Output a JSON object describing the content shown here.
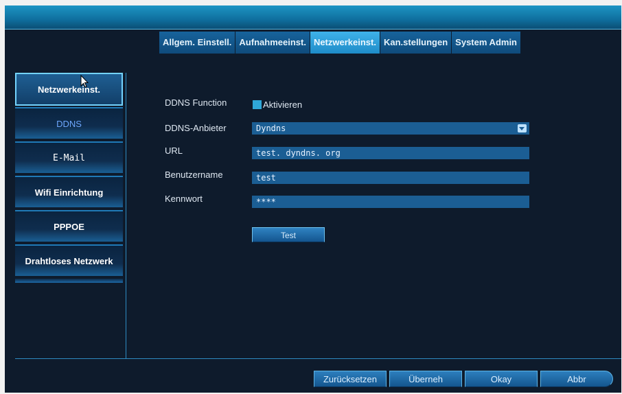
{
  "tabs": [
    {
      "label": "Allgem. Einstell."
    },
    {
      "label": "Aufnahmeeinst."
    },
    {
      "label": "Netzwerkeinst."
    },
    {
      "label": "Kan.stellungen"
    },
    {
      "label": "System Admin"
    }
  ],
  "active_tab": "Netzwerkeinst.",
  "sidebar": {
    "items": [
      {
        "label": "Netzwerkeinst."
      },
      {
        "label": "DDNS"
      },
      {
        "label": "E-Mail"
      },
      {
        "label": "Wifi Einrichtung"
      },
      {
        "label": "PPPOE"
      },
      {
        "label": "Drahtloses Netzwerk"
      }
    ],
    "selected": "Netzwerkeinst."
  },
  "form": {
    "ddns_function_label": "DDNS Function",
    "aktivieren_label": "Aktivieren",
    "aktivieren_checked": true,
    "provider_label": "DDNS-Anbieter",
    "provider_value": "Dyndns",
    "url_label": "URL",
    "url_value": "test. dyndns. org",
    "user_label": "Benutzername",
    "user_value": "test",
    "password_label": "Kennwort",
    "password_value": "****",
    "test_button": "Test"
  },
  "footer": {
    "reset": "Zurücksetzen",
    "apply": "Überneh",
    "ok": "Okay",
    "cancel": "Abbr"
  },
  "colors": {
    "background": "#0e1b2c",
    "accent": "#3fb2ea",
    "field": "#1b5e94"
  }
}
